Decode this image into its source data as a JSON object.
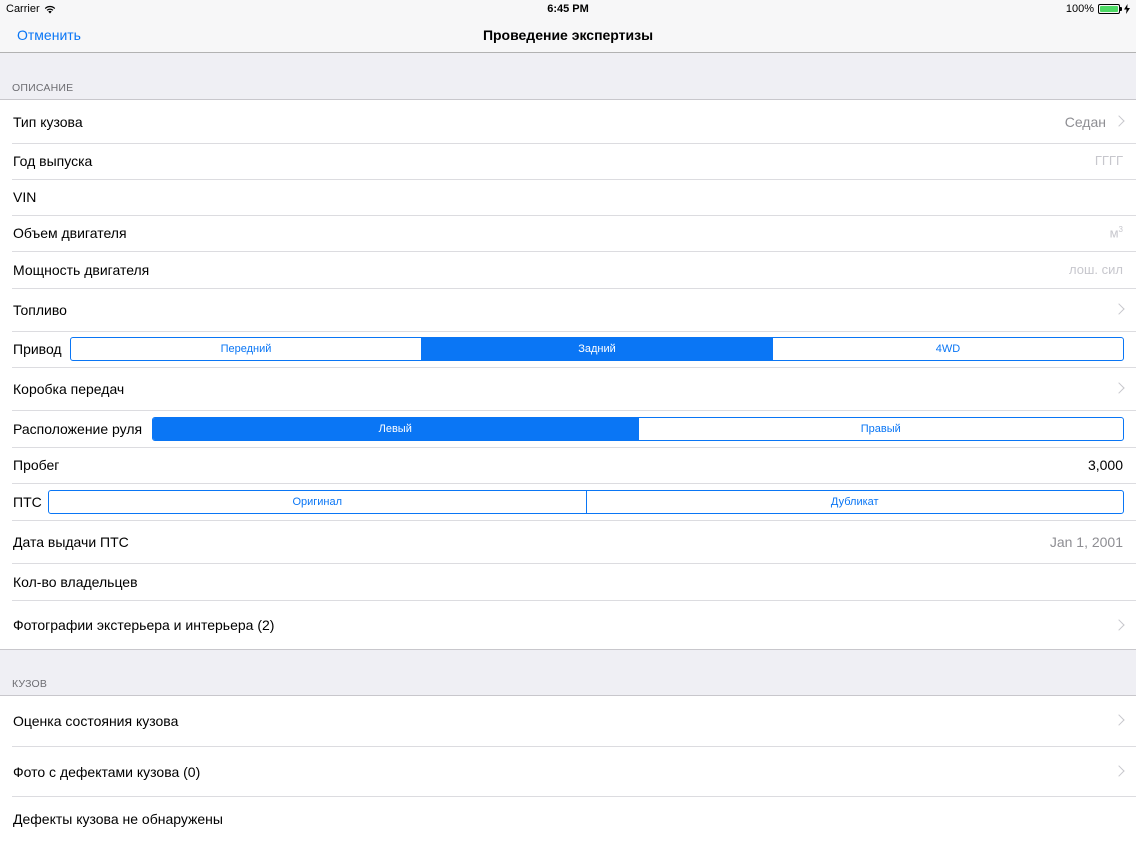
{
  "status": {
    "carrier": "Carrier",
    "time": "6:45 PM",
    "battery": "100%"
  },
  "nav": {
    "cancel": "Отменить",
    "title": "Проведение экспертизы"
  },
  "description": {
    "header": "ОПИСАНИЕ",
    "body_type": {
      "label": "Тип кузова",
      "value": "Седан"
    },
    "year": {
      "label": "Год выпуска",
      "placeholder": "ГГГГ"
    },
    "vin": {
      "label": "VIN"
    },
    "engine_volume": {
      "label": "Объем двигателя",
      "unit": "м",
      "unit_sup": "3"
    },
    "engine_power": {
      "label": "Мощность двигателя",
      "placeholder": "лош. сил"
    },
    "fuel": {
      "label": "Топливо"
    },
    "drive": {
      "label": "Привод",
      "options": [
        "Передний",
        "Задний",
        "4WD"
      ],
      "selected": 1
    },
    "gearbox": {
      "label": "Коробка передач"
    },
    "steering": {
      "label": "Расположение руля",
      "options": [
        "Левый",
        "Правый"
      ],
      "selected": 0
    },
    "mileage": {
      "label": "Пробег",
      "value": "3,000"
    },
    "pts": {
      "label": "ПТС",
      "options": [
        "Оригинал",
        "Дубликат"
      ],
      "selected": -1
    },
    "pts_date": {
      "label": "Дата выдачи ПТС",
      "value": "Jan 1, 2001"
    },
    "owners": {
      "label": "Кол-во владельцев"
    },
    "photos": {
      "label": "Фотографии экстерьера и интерьера (2)"
    }
  },
  "body": {
    "header": "КУЗОВ",
    "condition": {
      "label": "Оценка состояния кузова"
    },
    "defect_photos": {
      "label": "Фото с дефектами кузова (0)"
    },
    "no_defects": {
      "label": "Дефекты кузова не обнаружены"
    }
  }
}
